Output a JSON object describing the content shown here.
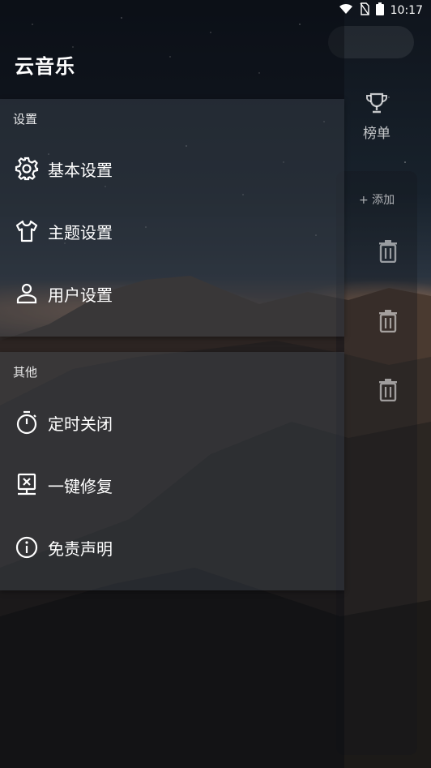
{
  "status_bar": {
    "time": "10:17",
    "icons": [
      "wifi-icon",
      "no-sim-icon",
      "battery-icon"
    ]
  },
  "drawer": {
    "app_title": "云音乐",
    "sections": [
      {
        "header": "设置",
        "items": [
          {
            "label": "基本设置",
            "icon": "gear-icon"
          },
          {
            "label": "主题设置",
            "icon": "tshirt-icon"
          },
          {
            "label": "用户设置",
            "icon": "user-icon"
          }
        ]
      },
      {
        "header": "其他",
        "items": [
          {
            "label": "定时关闭",
            "icon": "timer-icon"
          },
          {
            "label": "一键修复",
            "icon": "repair-icon"
          },
          {
            "label": "免责声明",
            "icon": "info-icon"
          }
        ]
      }
    ]
  },
  "main": {
    "nav_chart_label": "榜单",
    "add_label": "+ 添加"
  }
}
